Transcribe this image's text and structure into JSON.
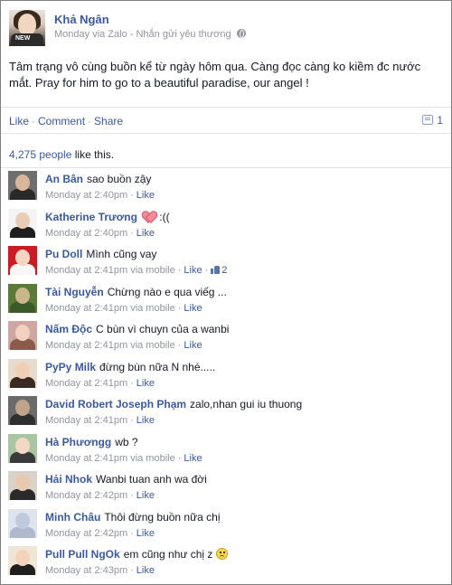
{
  "post": {
    "author": "Khả Ngân",
    "meta": "Monday via Zalo - Nhắn gửi yêu thương",
    "avatar_shirt_text": "NEW",
    "text": "Tâm trạng vô cùng buồn kể từ ngày hôm qua. Càng đọc càng ko kiềm đc nước mắt. Pray for him to go to a beautiful paradise, our angel !"
  },
  "actions": {
    "like": "Like",
    "sep": "·",
    "comment": "Comment",
    "share": "Share",
    "comment_count": "1"
  },
  "likes": {
    "count": "4,275 people",
    "rest": " like this."
  },
  "comments": [
    {
      "name": "An Bân",
      "text": "sao buồn zậy",
      "time": "Monday at 2:40pm",
      "via": "",
      "like": "Like",
      "likes": "",
      "emoji": ""
    },
    {
      "name": "Katherine Trương",
      "text": ":((",
      "time": "Monday at 2:40pm",
      "via": "",
      "like": "Like",
      "likes": "",
      "emoji": "heart"
    },
    {
      "name": "Pu Doll",
      "text": "Mình cũng vay",
      "time": "Monday at 2:41pm",
      "via": "via mobile",
      "like": "Like",
      "likes": "2",
      "emoji": ""
    },
    {
      "name": "Tài Nguyễn",
      "text": "Chừng nào e qua viếg ...",
      "time": "Monday at 2:41pm",
      "via": "via mobile",
      "like": "Like",
      "likes": "",
      "emoji": ""
    },
    {
      "name": "Nấm Độc",
      "text": "C bùn vì chuyn của a wanbi",
      "time": "Monday at 2:41pm",
      "via": "via mobile",
      "like": "Like",
      "likes": "",
      "emoji": ""
    },
    {
      "name": "PyPy Milk",
      "text": "đừng bùn nữa N nhé.....",
      "time": "Monday at 2:41pm",
      "via": "",
      "like": "Like",
      "likes": "",
      "emoji": ""
    },
    {
      "name": "David Robert Joseph Phạm",
      "text": "zalo,nhan gui iu thuong",
      "time": "Monday at 2:41pm",
      "via": "",
      "like": "Like",
      "likes": "",
      "emoji": ""
    },
    {
      "name": "Hà Phươngg",
      "text": "wb ?",
      "time": "Monday at 2:41pm",
      "via": "via mobile",
      "like": "Like",
      "likes": "",
      "emoji": ""
    },
    {
      "name": "Hải Nhok",
      "text": "Wanbi tuan anh wa đời",
      "time": "Monday at 2:42pm",
      "via": "",
      "like": "Like",
      "likes": "",
      "emoji": ""
    },
    {
      "name": "Minh Châu",
      "text": "Thôi đừng buồn nữa chị",
      "time": "Monday at 2:42pm",
      "via": "",
      "like": "Like",
      "likes": "",
      "emoji": ""
    },
    {
      "name": "Pull Pull NgOk",
      "text": "em cũng như chị z",
      "time": "Monday at 2:43pm",
      "via": "",
      "like": "Like",
      "likes": "",
      "emoji": "sad"
    }
  ],
  "avatar_colors": [
    {
      "bg": "#6f6f6f",
      "face": "#d9b59a",
      "body": "#2a2a2a"
    },
    {
      "bg": "#f4f4f4",
      "face": "#e9cdb6",
      "body": "#1e1e1e"
    },
    {
      "bg": "#c81d25",
      "face": "#f2d6c2",
      "body": "#f7f7f7"
    },
    {
      "bg": "#5b7a3a",
      "face": "#c9b68a",
      "body": "#3a5a2a"
    },
    {
      "bg": "#cfa6a2",
      "face": "#f1d1bf",
      "body": "#8a5a4a"
    },
    {
      "bg": "#e7dccb",
      "face": "#f0cfb5",
      "body": "#3b2a22"
    },
    {
      "bg": "#6b6b6b",
      "face": "#c0a38c",
      "body": "#2e2e2e"
    },
    {
      "bg": "#a7c6a1",
      "face": "#f3d8c6",
      "body": "#3a3a3a"
    },
    {
      "bg": "#d8d2c8",
      "face": "#e8c9b0",
      "body": "#2a2a2a"
    },
    {
      "bg": "#dfe3ee",
      "face": "#c1c9dc",
      "body": "#aeb8cf"
    },
    {
      "bg": "#efe6d8",
      "face": "#f2d4bd",
      "body": "#1f1f1f"
    }
  ]
}
